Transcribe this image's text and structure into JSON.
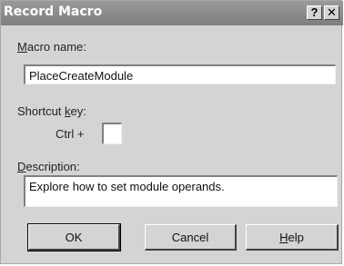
{
  "window": {
    "title": "Record Macro"
  },
  "titlebar": {
    "help_glyph": "?",
    "close_glyph": "✕"
  },
  "macro_name": {
    "label_prefix": "",
    "label_hotkey": "M",
    "label_rest": "acro name:",
    "value": "PlaceCreateModule"
  },
  "shortcut": {
    "label_prefix": "Shortcut ",
    "label_hotkey": "k",
    "label_rest": "ey:",
    "ctrl_label": "Ctrl +",
    "value": ""
  },
  "description": {
    "label_prefix": "",
    "label_hotkey": "D",
    "label_rest": "escription:",
    "value": "Explore how to set module operands."
  },
  "buttons": {
    "ok": "OK",
    "cancel": "Cancel",
    "help_hotkey": "H",
    "help_rest": "elp"
  }
}
